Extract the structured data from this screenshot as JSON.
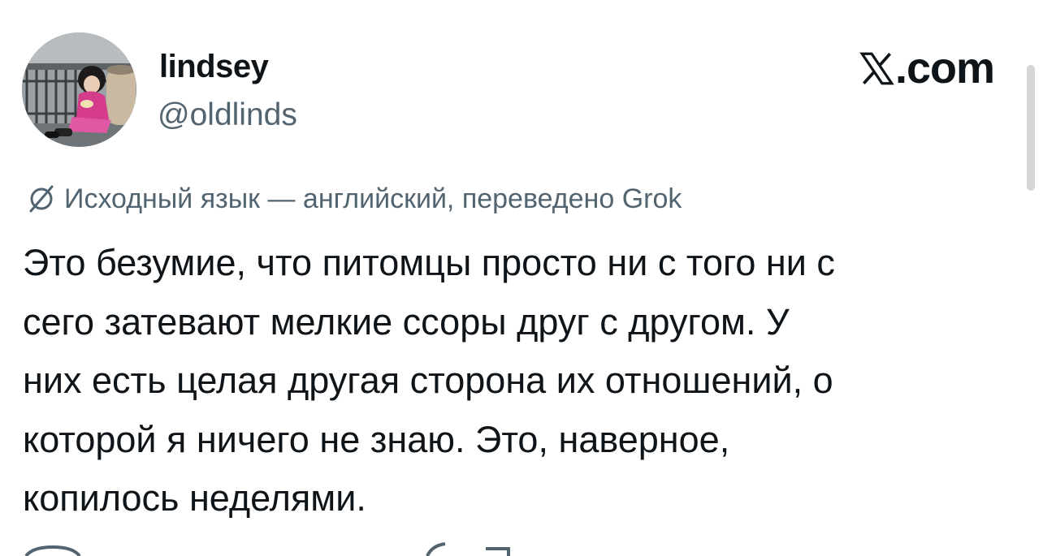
{
  "author": {
    "display_name": "lindsey",
    "handle": "@oldlinds",
    "avatar_alt": "profile-photo"
  },
  "brand": {
    "logo_icon": "x-logo-icon",
    "text": ".com"
  },
  "translation": {
    "icon": "translate-icon",
    "note": "Исходный язык — английский, переведено Grok"
  },
  "tweet": {
    "text": "Это безумие, что питомцы просто ни с того ни с\nсего затевают мелкие ссоры друг с другом. У\nних есть целая другая сторона их отношений, о\nкоторой я ничего не знаю. Это, наверное,\nкопилось неделями."
  },
  "colors": {
    "text_primary": "#0f1419",
    "text_secondary": "#536471",
    "background": "#ffffff"
  }
}
